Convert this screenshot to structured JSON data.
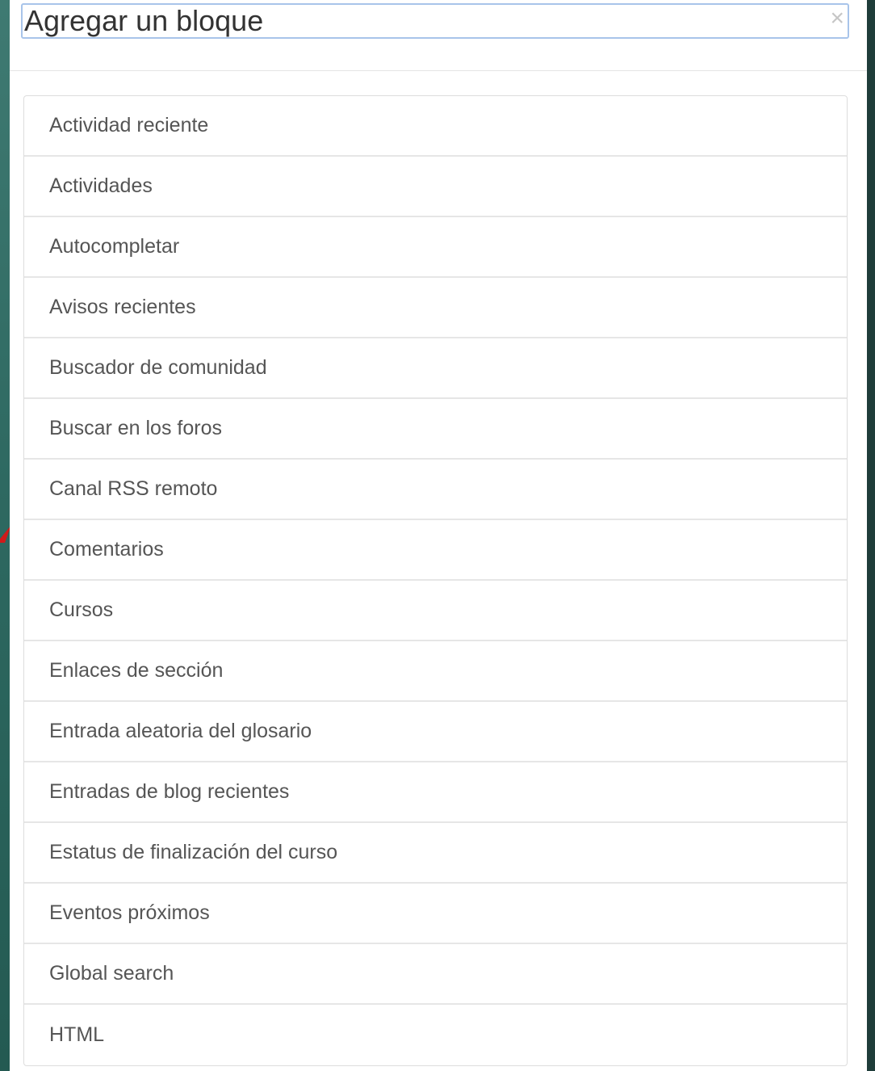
{
  "modal": {
    "title": "Agregar un bloque",
    "close_glyph": "×"
  },
  "blocks": [
    "Actividad reciente",
    "Actividades",
    "Autocompletar",
    "Avisos recientes",
    "Buscador de comunidad",
    "Buscar en los foros",
    "Canal RSS remoto",
    "Comentarios",
    "Cursos",
    "Enlaces de sección",
    "Entrada aleatoria del glosario",
    "Entradas de blog recientes",
    "Estatus de finalización del curso",
    "Eventos próximos",
    "Global search",
    "HTML"
  ],
  "colors": {
    "header_focus_border": "#a8c4ea",
    "item_text": "#555555",
    "backdrop": "#2f5f5a"
  }
}
